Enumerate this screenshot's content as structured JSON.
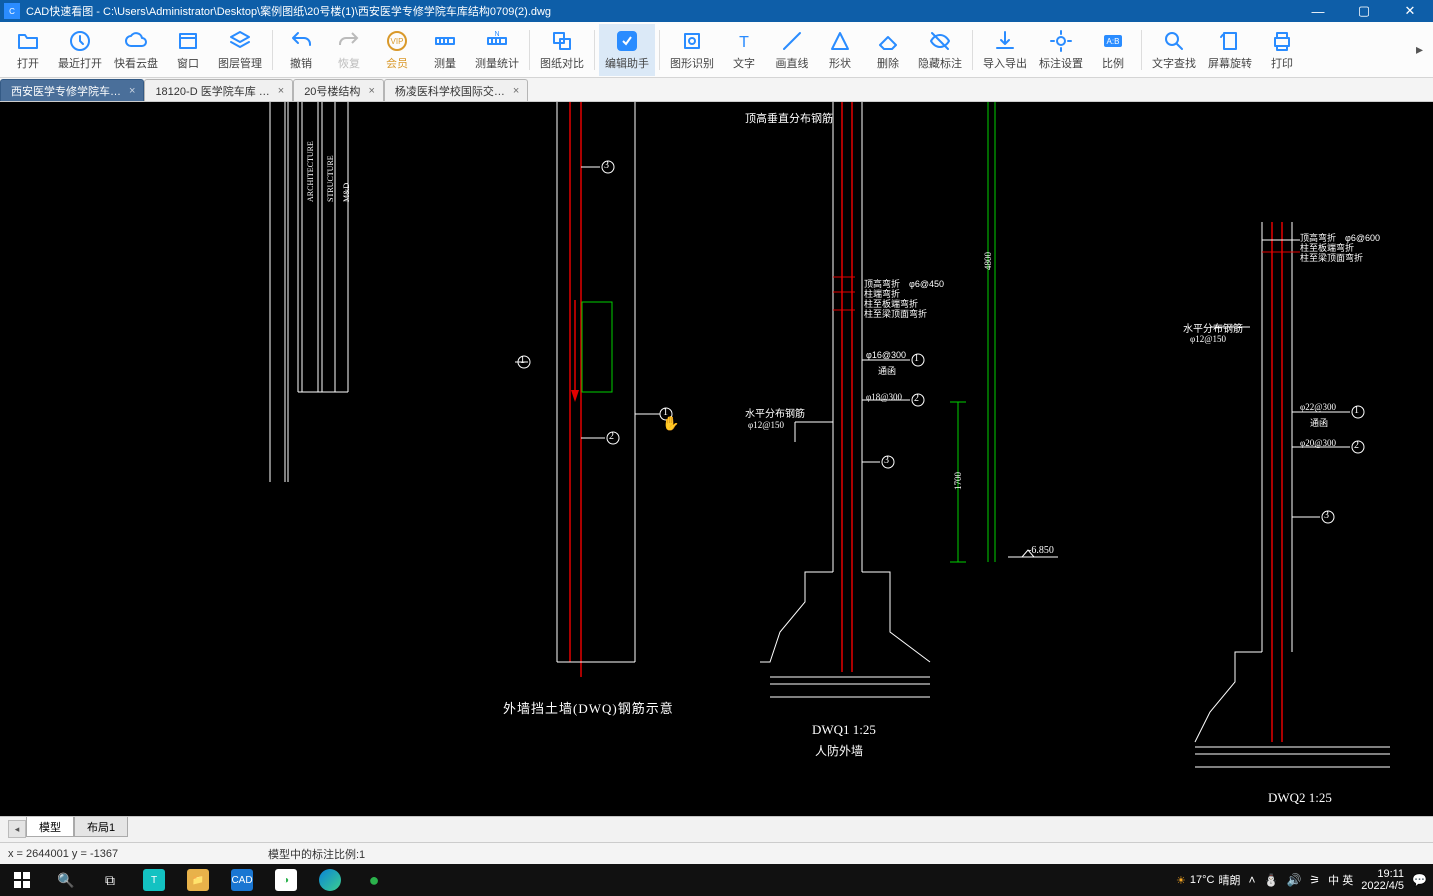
{
  "window": {
    "app_name": "CAD快速看图",
    "file_path": "C:\\Users\\Administrator\\Desktop\\案例图纸\\20号楼(1)\\西安医学专修学院车库结构0709(2).dwg"
  },
  "toolbar": [
    {
      "id": "open",
      "label": "打开"
    },
    {
      "id": "recent",
      "label": "最近打开"
    },
    {
      "id": "cloud",
      "label": "快看云盘"
    },
    {
      "id": "window",
      "label": "窗口"
    },
    {
      "id": "layer",
      "label": "图层管理"
    },
    {
      "id": "undo",
      "label": "撤销",
      "sep_before": true
    },
    {
      "id": "redo",
      "label": "恢复",
      "dim": true
    },
    {
      "id": "vip",
      "label": "会员",
      "vip": true
    },
    {
      "id": "measure",
      "label": "测量"
    },
    {
      "id": "measure-stat",
      "label": "测量统计"
    },
    {
      "id": "compare",
      "label": "图纸对比",
      "sep_before": true
    },
    {
      "id": "edit-helper",
      "label": "编辑助手",
      "active": true,
      "sep_before": true
    },
    {
      "id": "shape-rec",
      "label": "图形识别",
      "sep_before": true
    },
    {
      "id": "text",
      "label": "文字"
    },
    {
      "id": "line",
      "label": "画直线"
    },
    {
      "id": "shape",
      "label": "形状"
    },
    {
      "id": "delete",
      "label": "删除"
    },
    {
      "id": "hide-anno",
      "label": "隐藏标注"
    },
    {
      "id": "import-export",
      "label": "导入导出",
      "sep_before": true
    },
    {
      "id": "anno-set",
      "label": "标注设置"
    },
    {
      "id": "ratio",
      "label": "比例"
    },
    {
      "id": "search-text",
      "label": "文字查找",
      "sep_before": true
    },
    {
      "id": "rotate",
      "label": "屏幕旋转"
    },
    {
      "id": "print",
      "label": "打印"
    }
  ],
  "tabs": [
    {
      "label": "西安医学专修学院车…",
      "active": true
    },
    {
      "label": "18120-D 医学院车库 …",
      "active": false
    },
    {
      "label": "20号楼结构",
      "active": false
    },
    {
      "label": "杨凌医科学校国际交…",
      "active": false
    }
  ],
  "drawing": {
    "labels": {
      "top_right": "顶高垂直分布钢筋",
      "caption1": "外墙挡土墙(DWQ)钢筋示意",
      "title2": "DWQ1  1:25",
      "sub2": "人防外墙",
      "title3": "DWQ2  1:25",
      "horiz_bar": "水平分布钢筋",
      "horiz_bar_spec": "φ12@150",
      "elev": "-6.850",
      "spec1": "φ16@300",
      "spec1b": "通函",
      "spec2": "φ18@300",
      "spec3": "φ22@300",
      "spec3b": "通函",
      "spec4": "φ20@300",
      "spec5": "φ6@450",
      "spec5b": "φ6@600",
      "dim1": "4800",
      "dim2": "1700",
      "arch": "ARCHITECTURE",
      "struct": "STRUCTURE",
      "ms": "M&D",
      "note1": "顶高弯折",
      "note2": "柱端弯折",
      "note3": "柱至板端弯折",
      "note4": "柱至梁顶面弯折",
      "horiz_bar2": "水平分布钢筋",
      "horiz_bar2_spec": "φ12@150"
    },
    "callouts": [
      "1",
      "2",
      "3"
    ]
  },
  "layout_tabs": {
    "model": "模型",
    "layout1": "布局1"
  },
  "status": {
    "x": "2644001",
    "y": "-1367",
    "coord_prefix_x": "x = ",
    "coord_prefix_y": "  y = ",
    "scale_label": "模型中的标注比例:1"
  },
  "taskbar": {
    "weather_temp": "17°C",
    "weather_desc": "晴朗",
    "ime": "英",
    "ime2": "中",
    "time": "19:11",
    "date": "2022/4/5"
  }
}
